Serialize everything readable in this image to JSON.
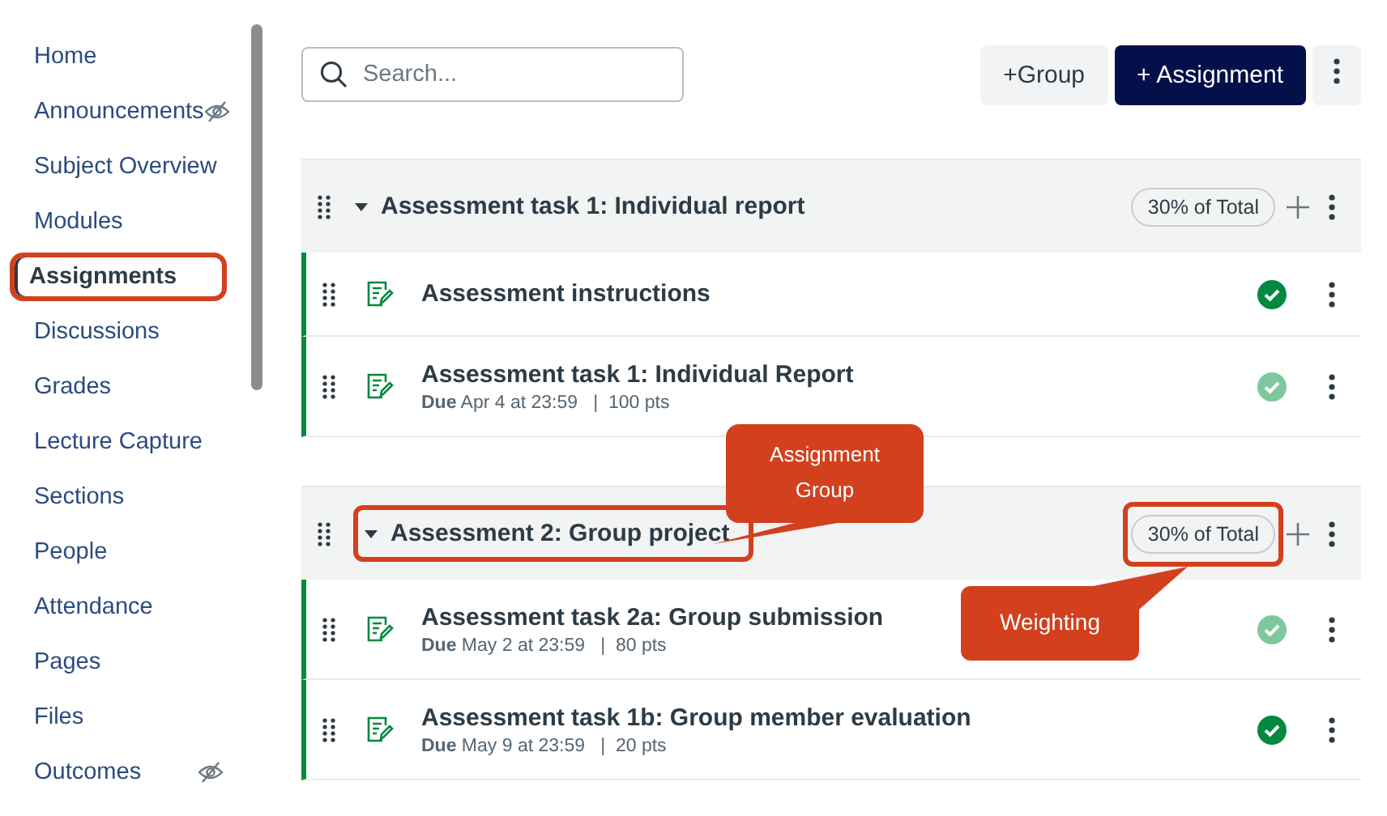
{
  "sidebar": {
    "items": [
      {
        "label": "Home",
        "selected": false,
        "hidden": false,
        "highlighted": false
      },
      {
        "label": "Announcements",
        "selected": false,
        "hidden": true,
        "highlighted": false
      },
      {
        "label": "Subject Overview",
        "selected": false,
        "hidden": false,
        "highlighted": false
      },
      {
        "label": "Modules",
        "selected": false,
        "hidden": false,
        "highlighted": false
      },
      {
        "label": "Assignments",
        "selected": true,
        "hidden": false,
        "highlighted": true
      },
      {
        "label": "Discussions",
        "selected": false,
        "hidden": false,
        "highlighted": false
      },
      {
        "label": "Grades",
        "selected": false,
        "hidden": false,
        "highlighted": false
      },
      {
        "label": "Lecture Capture",
        "selected": false,
        "hidden": false,
        "highlighted": false
      },
      {
        "label": "Sections",
        "selected": false,
        "hidden": false,
        "highlighted": false
      },
      {
        "label": "People",
        "selected": false,
        "hidden": false,
        "highlighted": false
      },
      {
        "label": "Attendance",
        "selected": false,
        "hidden": false,
        "highlighted": false
      },
      {
        "label": "Pages",
        "selected": false,
        "hidden": false,
        "highlighted": false
      },
      {
        "label": "Files",
        "selected": false,
        "hidden": false,
        "highlighted": false
      },
      {
        "label": "Outcomes",
        "selected": false,
        "hidden": true,
        "highlighted": false
      }
    ]
  },
  "search": {
    "placeholder": "Search..."
  },
  "toolbar": {
    "add_group": "+Group",
    "add_assignment": "+ Assignment"
  },
  "groups": [
    {
      "title": "Assessment task 1: Individual report",
      "weight": "30% of Total",
      "title_highlighted": false,
      "weight_highlighted": false,
      "expanded": true,
      "items": [
        {
          "title": "Assessment instructions",
          "published": true
        },
        {
          "title": "Assessment task 1: Individual Report",
          "details": "**Due** Apr 4 at 23:59   |  100 pts",
          "published": false
        }
      ]
    },
    {
      "title": "Assessment 2: Group project",
      "weight": "30% of Total",
      "title_highlighted": true,
      "weight_highlighted": true,
      "expanded": true,
      "items": [
        {
          "title": "Assessment task 2a: Group submission",
          "details": "**Due** May 2 at 23:59   |  80 pts",
          "published": false
        },
        {
          "title": "Assessment task 1b: Group member evaluation",
          "details": "**Due** May 9 at 23:59   |  20 pts",
          "published": true
        }
      ]
    }
  ],
  "callouts": [
    {
      "text": "Assignment Group"
    },
    {
      "text": "Weighting"
    }
  ]
}
